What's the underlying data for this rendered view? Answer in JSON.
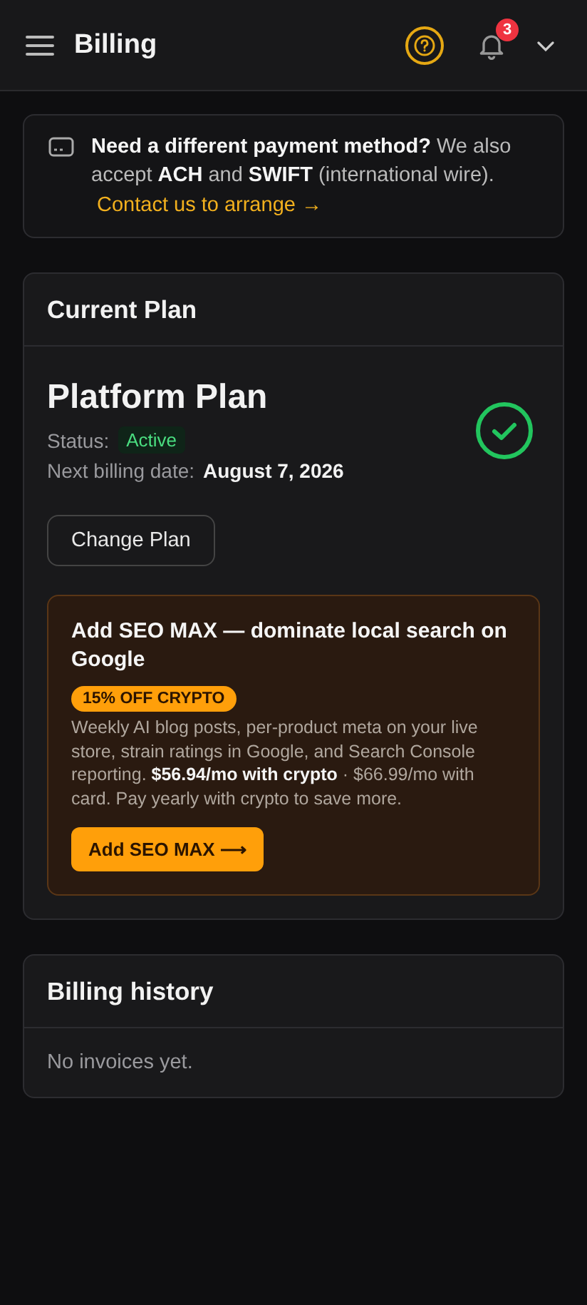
{
  "header": {
    "title": "Billing",
    "notification_count": "3"
  },
  "notice": {
    "text": "**Need a different payment method?** We also accept **ACH** and **SWIFT** (international wire).",
    "link": "Contact us to arrange →"
  },
  "current_plan": {
    "heading": "Current Plan",
    "plan_name": "Platform Plan",
    "status_label": "Status:",
    "status": "Active",
    "active": true,
    "billing_label": "Next billing date:",
    "billing_date": "August 7, 2026",
    "change_button": "Change Plan",
    "upsell": {
      "title": "Add SEO MAX — dominate local search on Google",
      "badge": "15% OFF CRYPTO",
      "description": "Weekly AI blog posts, per-product meta on your live store, strain ratings in Google, and Search Console reporting. **$56.94/mo with crypto** · $66.99/mo with card. Pay yearly with crypto to save more.",
      "button": "Add SEO MAX ⟶"
    }
  },
  "billing_history": {
    "heading": "Billing history",
    "empty_text": "No invoices yet."
  }
}
